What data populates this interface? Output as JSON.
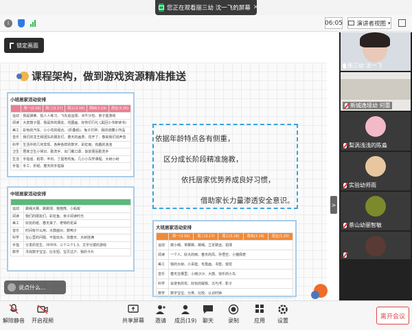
{
  "banner": {
    "text": "您正在观看丽三幼 沈一飞的屏幕"
  },
  "topbar": {
    "timer": "06:05",
    "presenter_view": "演讲者视图"
  },
  "stage": {
    "lock_label": "锁定画面",
    "slide_title": "课程架构，做到游戏资源精准推送",
    "quote": [
      "依据年龄特点各有侧重，",
      "区分成长阶段精准施教，",
      "依托居家优势养成良好习惯，",
      "借助家长力量渗透安全意识。"
    ],
    "cards": {
      "small": {
        "title": "小班居家活动安排",
        "header": [
          "",
          "周一(3.16)",
          "周二(3.17)",
          "周三(3.18)",
          "周四(3.19)",
          "周五(3.20)"
        ],
        "rows": [
          "运动",
          "阅读",
          "美工",
          "音乐",
          "科学",
          "卫生",
          "生活",
          "手指"
        ],
        "notes": [
          "我是弹簧、拍人人练习、飞先追运球、点牛沙包、亲子能游戏",
          "大皮鼓子图、我是你的朋友、花圃画、好你们行礼 (黑回小书架读书)",
          "彩色的汽车、小小花的组合、(折叠纸)、兔子打碎、我的收藏小作品",
          "我们的龙王和团队的朋友们、春天的画表、花开了、春来我们找声音",
          "生活中的几何发现、各种各样的数字、彩虹雨、有趣的泡泡",
          "居家卫生小常识、勤洗手、出门戴口罩、饭前便后勤洗手",
          "手指谣、稻草、丰石、丁屋地鸡兔、几小小鸟学课程、大树小树",
          "手工、折纸、春天的手指操"
        ]
      },
      "middle": {
        "title": "中班居家活动安排",
        "rows": [
          "运动",
          "阅读",
          "美工",
          "音乐",
          "科学",
          "手指",
          "数学"
        ],
        "notes": [
          "跳绳大赛、跳跳球、抱抱熊、小蚂蚁",
          "我们的朋友们、彩虹鱼、亲子阅读时光",
          "好玩的纸、春天来了、奇特的花朵",
          "时间有什么用、大鼓面对、数鸭子",
          "在心里的问题、不能玩水、找春天、大树挂满",
          "分发的花生、冲冲冲、三个三个1.3、文字分拨的游戏",
          "寻找数字宝宝、比长短、宝贝过户、我的卡片"
        ]
      },
      "large": {
        "title": "大班居家活动安排",
        "header": [
          "",
          "周一(3.16)",
          "周二(3.17)",
          "周三(3.18)",
          "周四(3.19)",
          "周五(3.20)"
        ],
        "rows": [
          "运动",
          "阅读",
          "美工",
          "音乐",
          "科学",
          "数学"
        ],
        "notes": [
          "跳小绳、单脚跳、跳绳、立定跳远、拍球",
          "一个人、好大的雨、春天的风、孙悟空、小猪佩奇",
          "我的大树、小青蛙、毛笔画、书签、窗花",
          "春天在哪里、小雨沙沙、大鼓、快乐的小鸟",
          "会变色的花、好玩的磁铁、沉与浮、影子",
          "数字宝宝、分类、比较、认识时钟"
        ]
      }
    },
    "chat_preview": "说点什么...",
    "collapse_arrow": ">"
  },
  "videos": [
    {
      "name": "丽三幼 沈一飞",
      "mic": "on"
    },
    {
      "name": "新城逸境幼 何蕾",
      "mic": "off"
    },
    {
      "name": "梨涡浅浅的陈淼",
      "mic": "off"
    },
    {
      "name": "实验幼师雨",
      "mic": "off"
    },
    {
      "name": "茶山幼丽智敏",
      "mic": "off"
    },
    {
      "name": "",
      "mic": "off"
    }
  ],
  "bottombar": {
    "mute": "解除静音",
    "video": "开启视频",
    "share": "共享屏幕",
    "invite": "邀请",
    "members": "成员(19)",
    "chat": "聊天",
    "record": "录制",
    "apps": "应用",
    "settings": "设置",
    "leave": "离开会议"
  },
  "colors": {
    "accent": "#2f7de1",
    "leave": "#e04545",
    "pink": "#ea7f93",
    "green": "#5cb87c",
    "orange": "#f08a37"
  }
}
